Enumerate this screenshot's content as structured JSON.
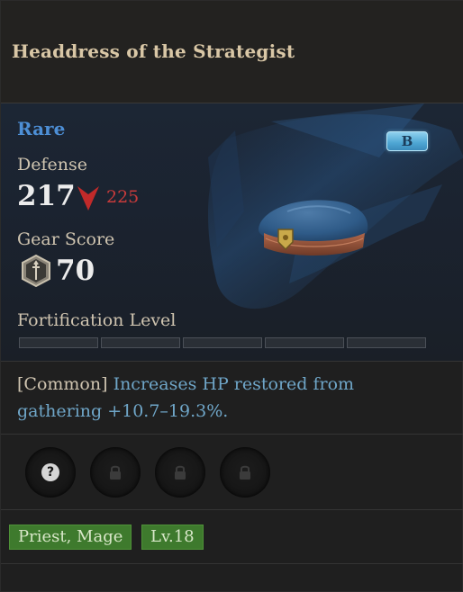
{
  "item": {
    "name": "Headdress of the Strategist",
    "rarity": "Rare",
    "rarity_color": "#4d8fd6",
    "grade": "B",
    "image_icon": "blue-beret-hat"
  },
  "stats": {
    "defense_label": "Defense",
    "defense_value": "217",
    "defense_compare_value": "225",
    "defense_compare_icon": "down-arrow-icon",
    "defense_compare_color": "#c83b3b",
    "gear_score_label": "Gear Score",
    "gear_score_value": "70",
    "gear_score_icon": "gear-score-shield-icon",
    "fortification_label": "Fortification Level",
    "fortification_filled": 0,
    "fortification_total": 5
  },
  "effect": {
    "tier": "[Common]",
    "description": "Increases HP restored from gathering +10.7–19.3%."
  },
  "sockets": [
    {
      "state": "unknown",
      "icon": "question-mark-icon"
    },
    {
      "state": "locked",
      "icon": "lock-icon"
    },
    {
      "state": "locked",
      "icon": "lock-icon"
    },
    {
      "state": "locked",
      "icon": "lock-icon"
    }
  ],
  "tags": {
    "classes": "Priest, Mage",
    "level": "Lv.18"
  }
}
